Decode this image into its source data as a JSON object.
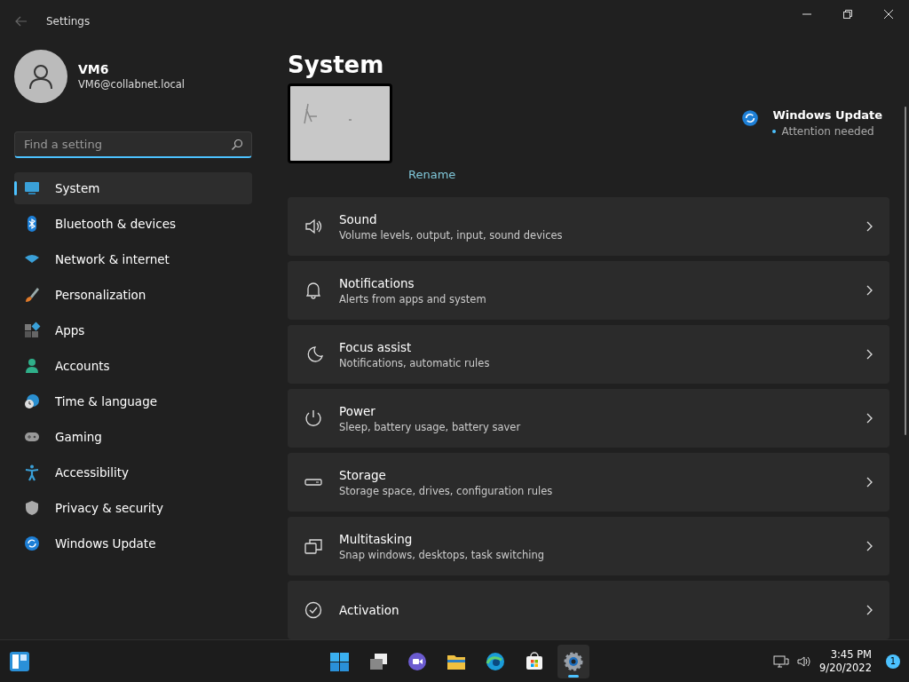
{
  "window": {
    "title": "Settings"
  },
  "account": {
    "name": "VM6",
    "email": "VM6@collabnet.local"
  },
  "search": {
    "placeholder": "Find a setting"
  },
  "sidebar": {
    "items": [
      {
        "label": "System",
        "selected": true
      },
      {
        "label": "Bluetooth & devices",
        "selected": false
      },
      {
        "label": "Network & internet",
        "selected": false
      },
      {
        "label": "Personalization",
        "selected": false
      },
      {
        "label": "Apps",
        "selected": false
      },
      {
        "label": "Accounts",
        "selected": false
      },
      {
        "label": "Time & language",
        "selected": false
      },
      {
        "label": "Gaming",
        "selected": false
      },
      {
        "label": "Accessibility",
        "selected": false
      },
      {
        "label": "Privacy & security",
        "selected": false
      },
      {
        "label": "Windows Update",
        "selected": false
      }
    ]
  },
  "page": {
    "title": "System",
    "rename": "Rename",
    "update": {
      "title": "Windows Update",
      "status": "Attention needed"
    }
  },
  "rows": [
    {
      "title": "Sound",
      "subtitle": "Volume levels, output, input, sound devices"
    },
    {
      "title": "Notifications",
      "subtitle": "Alerts from apps and system"
    },
    {
      "title": "Focus assist",
      "subtitle": "Notifications, automatic rules"
    },
    {
      "title": "Power",
      "subtitle": "Sleep, battery usage, battery saver"
    },
    {
      "title": "Storage",
      "subtitle": "Storage space, drives, configuration rules"
    },
    {
      "title": "Multitasking",
      "subtitle": "Snap windows, desktops, task switching"
    },
    {
      "title": "Activation"
    }
  ],
  "taskbar": {
    "apps": [
      {
        "selected": false
      },
      {
        "selected": false
      },
      {
        "selected": false
      },
      {
        "selected": false
      },
      {
        "selected": false
      },
      {
        "selected": false
      },
      {
        "selected": true
      }
    ],
    "time": "3:45 PM",
    "date": "9/20/2022",
    "badge": "1"
  }
}
